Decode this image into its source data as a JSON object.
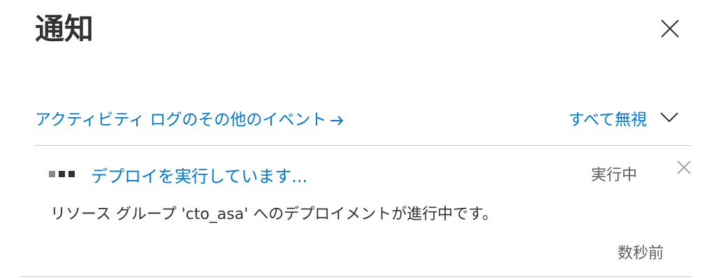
{
  "header": {
    "title": "通知"
  },
  "actions": {
    "activity_log_link": "アクティビティ ログのその他のイベント",
    "dismiss_all": "すべて無視"
  },
  "notification": {
    "title": "デプロイを実行しています...",
    "status": "実行中",
    "message": "リソース グループ 'cto_asa' へのデプロイメントが進行中です。",
    "timestamp": "数秒前"
  },
  "icons": {
    "close": "close-icon",
    "arrow": "arrow-right-icon",
    "chevron": "chevron-down-icon",
    "progress": "progress-dots-icon",
    "dismiss": "dismiss-icon"
  },
  "colors": {
    "link": "#0078d4",
    "text": "#323130",
    "secondary": "#605e5c",
    "divider": "#c8c6c4"
  }
}
